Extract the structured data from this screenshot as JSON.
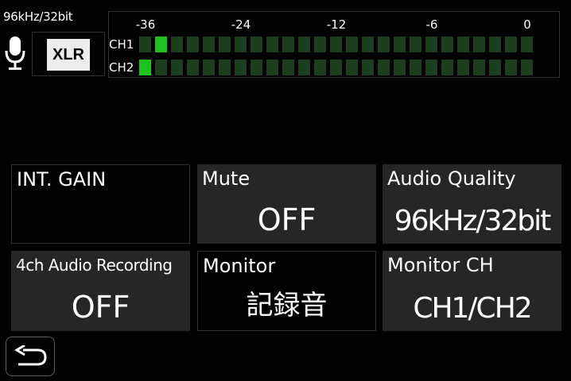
{
  "status": {
    "audio_format": "96kHz/32bit"
  },
  "input": {
    "mic_icon": "microphone-icon",
    "source_label": "XLR"
  },
  "level_meter": {
    "scale_labels": [
      "-36",
      "-24",
      "-12",
      "-6",
      "0"
    ],
    "channels": [
      {
        "label": "CH1",
        "segments": 25,
        "lit": [
          1
        ]
      },
      {
        "label": "CH2",
        "segments": 25,
        "lit": [
          0
        ]
      }
    ],
    "colors": {
      "lit": "#1cc31c",
      "unlit": "#1c3e1c"
    }
  },
  "settings": {
    "int_gain": {
      "label": "INT. GAIN",
      "value": ""
    },
    "mute": {
      "label": "Mute",
      "value": "OFF"
    },
    "audio_quality": {
      "label": "Audio Quality",
      "value": "96kHz/32bit"
    },
    "four_ch_recording": {
      "label": "4ch Audio Recording",
      "value": "OFF"
    },
    "monitor": {
      "label": "Monitor",
      "value": "記録音"
    },
    "monitor_ch": {
      "label": "Monitor CH",
      "value": "CH1/CH2"
    }
  },
  "back": {
    "icon": "return-arrow-icon"
  }
}
